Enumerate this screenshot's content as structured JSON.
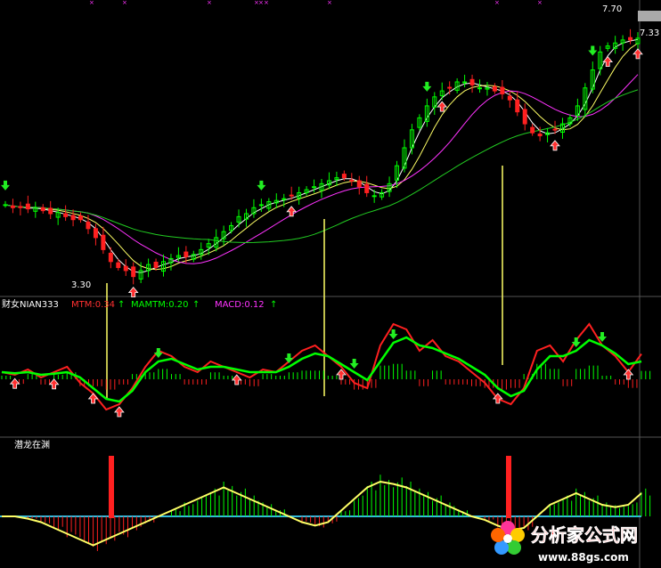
{
  "colors": {
    "bg": "#000000",
    "up": "#00ff00",
    "down": "#ff2020",
    "white_line": "#ffffff",
    "yellow_line": "#ffff66",
    "magenta_line": "#ff33ff",
    "green_line": "#22cc22",
    "cyan_line": "#33bbdd",
    "panel_sep": "#555555",
    "vline": "#ffff66"
  },
  "price_labels": {
    "high": "7.70",
    "low": "3.30",
    "right": "7.33"
  },
  "panel2": {
    "title": "财女NIAN333",
    "mtm": "MTM:0.34",
    "mtm_arrow": "↑",
    "mamtm": "MAMTM:0.20",
    "mamtm_arrow": "↑",
    "macd": "MACD:0.12",
    "macd_arrow": "↑"
  },
  "panel3": {
    "title": "潜龙在渊"
  },
  "watermark": {
    "cn": "分析家公式网",
    "url": "www.88gs.com"
  },
  "chart_data": [
    {
      "type": "line",
      "title": "",
      "price_high": 7.7,
      "price_low": 3.3,
      "price_last": 7.33,
      "series": [
        {
          "values": [
            4.55,
            4.5,
            4.5,
            4.48,
            4.5,
            4.45,
            4.4,
            4.42,
            4.35,
            4.3,
            4.3,
            4.15,
            4.0,
            3.8,
            3.6,
            3.5,
            3.45,
            3.35,
            3.45,
            3.55,
            3.5,
            3.6,
            3.65,
            3.7,
            3.68,
            3.72,
            3.8,
            3.9,
            4.0,
            4.1,
            4.2,
            4.35,
            4.4,
            4.5,
            4.55,
            4.6,
            4.62,
            4.65,
            4.7,
            4.75,
            4.8,
            4.85,
            4.9,
            4.95,
            5.0,
            5.0,
            4.95,
            4.85,
            4.75,
            4.7,
            4.75,
            4.9,
            5.2,
            5.5,
            5.8,
            6.0,
            6.2,
            6.35,
            6.45,
            6.5,
            6.6,
            6.6,
            6.55,
            6.5,
            6.5,
            6.45,
            6.4,
            6.3,
            6.1,
            5.9,
            5.75,
            5.7,
            5.75,
            5.8,
            5.9,
            6.0,
            6.2,
            6.5,
            6.8,
            7.1,
            7.2,
            7.25,
            7.3,
            7.3,
            7.33
          ]
        }
      ],
      "ma_lines": [
        "white",
        "yellow",
        "magenta",
        "green"
      ],
      "up_arrows_at": [
        17,
        38,
        58,
        73,
        80,
        84
      ],
      "down_arrows_at": [
        0,
        34,
        56,
        78
      ]
    },
    {
      "type": "line",
      "series": [
        {
          "values": [
            0.0,
            -0.05,
            0.05,
            -0.1,
            0.0,
            0.1,
            -0.2,
            -0.4,
            -0.7,
            -0.6,
            -0.3,
            0.1,
            0.4,
            0.3,
            0.1,
            0.0,
            0.2,
            0.1,
            0.0,
            -0.1,
            0.05,
            0.0,
            0.2,
            0.4,
            0.5,
            0.3,
            0.1,
            -0.2,
            -0.3,
            0.5,
            0.9,
            0.8,
            0.4,
            0.6,
            0.3,
            0.2,
            0.0,
            -0.2,
            -0.5,
            -0.6,
            -0.3,
            0.4,
            0.5,
            0.2,
            0.6,
            0.9,
            0.5,
            0.3,
            0.0,
            0.34
          ]
        },
        {
          "values": [
            0.0,
            -0.02,
            0.0,
            -0.05,
            -0.03,
            0.0,
            -0.1,
            -0.3,
            -0.5,
            -0.55,
            -0.35,
            0.0,
            0.2,
            0.25,
            0.15,
            0.05,
            0.1,
            0.1,
            0.05,
            0.0,
            0.0,
            0.0,
            0.1,
            0.25,
            0.35,
            0.3,
            0.15,
            0.0,
            -0.15,
            0.2,
            0.55,
            0.65,
            0.5,
            0.45,
            0.35,
            0.25,
            0.1,
            -0.05,
            -0.3,
            -0.45,
            -0.35,
            0.05,
            0.3,
            0.3,
            0.4,
            0.6,
            0.5,
            0.35,
            0.15,
            0.2
          ]
        }
      ],
      "macd": 0.12
    },
    {
      "type": "line",
      "series": [
        {
          "values": [
            0.0,
            0.0,
            -0.02,
            -0.05,
            -0.1,
            -0.15,
            -0.2,
            -0.25,
            -0.2,
            -0.15,
            -0.1,
            -0.05,
            0.0,
            0.05,
            0.1,
            0.15,
            0.2,
            0.25,
            0.2,
            0.15,
            0.1,
            0.05,
            0.0,
            -0.05,
            -0.08,
            -0.05,
            0.05,
            0.15,
            0.25,
            0.3,
            0.28,
            0.25,
            0.2,
            0.15,
            0.1,
            0.05,
            0.0,
            -0.03,
            -0.08,
            -0.12,
            -0.1,
            0.0,
            0.1,
            0.15,
            0.2,
            0.15,
            0.1,
            0.08,
            0.1,
            0.2
          ]
        },
        {
          "values": [
            0.0,
            0.0,
            0.0,
            0.0,
            0.0,
            0.0,
            0.0,
            0.0,
            0.0,
            0.0,
            0.0,
            0.0,
            0.0,
            0.0,
            0.0,
            0.0,
            0.0,
            0.0,
            0.0,
            0.0,
            0.0,
            0.0,
            0.0,
            0.0,
            0.0,
            0.0,
            0.0,
            0.0,
            0.0,
            0.0,
            0.0,
            0.0,
            0.0,
            0.0,
            0.0,
            0.0,
            0.0,
            0.0,
            0.0,
            0.0,
            0.0,
            0.0,
            0.0,
            0.0,
            0.0,
            0.0,
            0.0,
            0.0,
            0.0,
            0.0
          ]
        }
      ],
      "red_signal_at": [
        9,
        38
      ]
    }
  ]
}
